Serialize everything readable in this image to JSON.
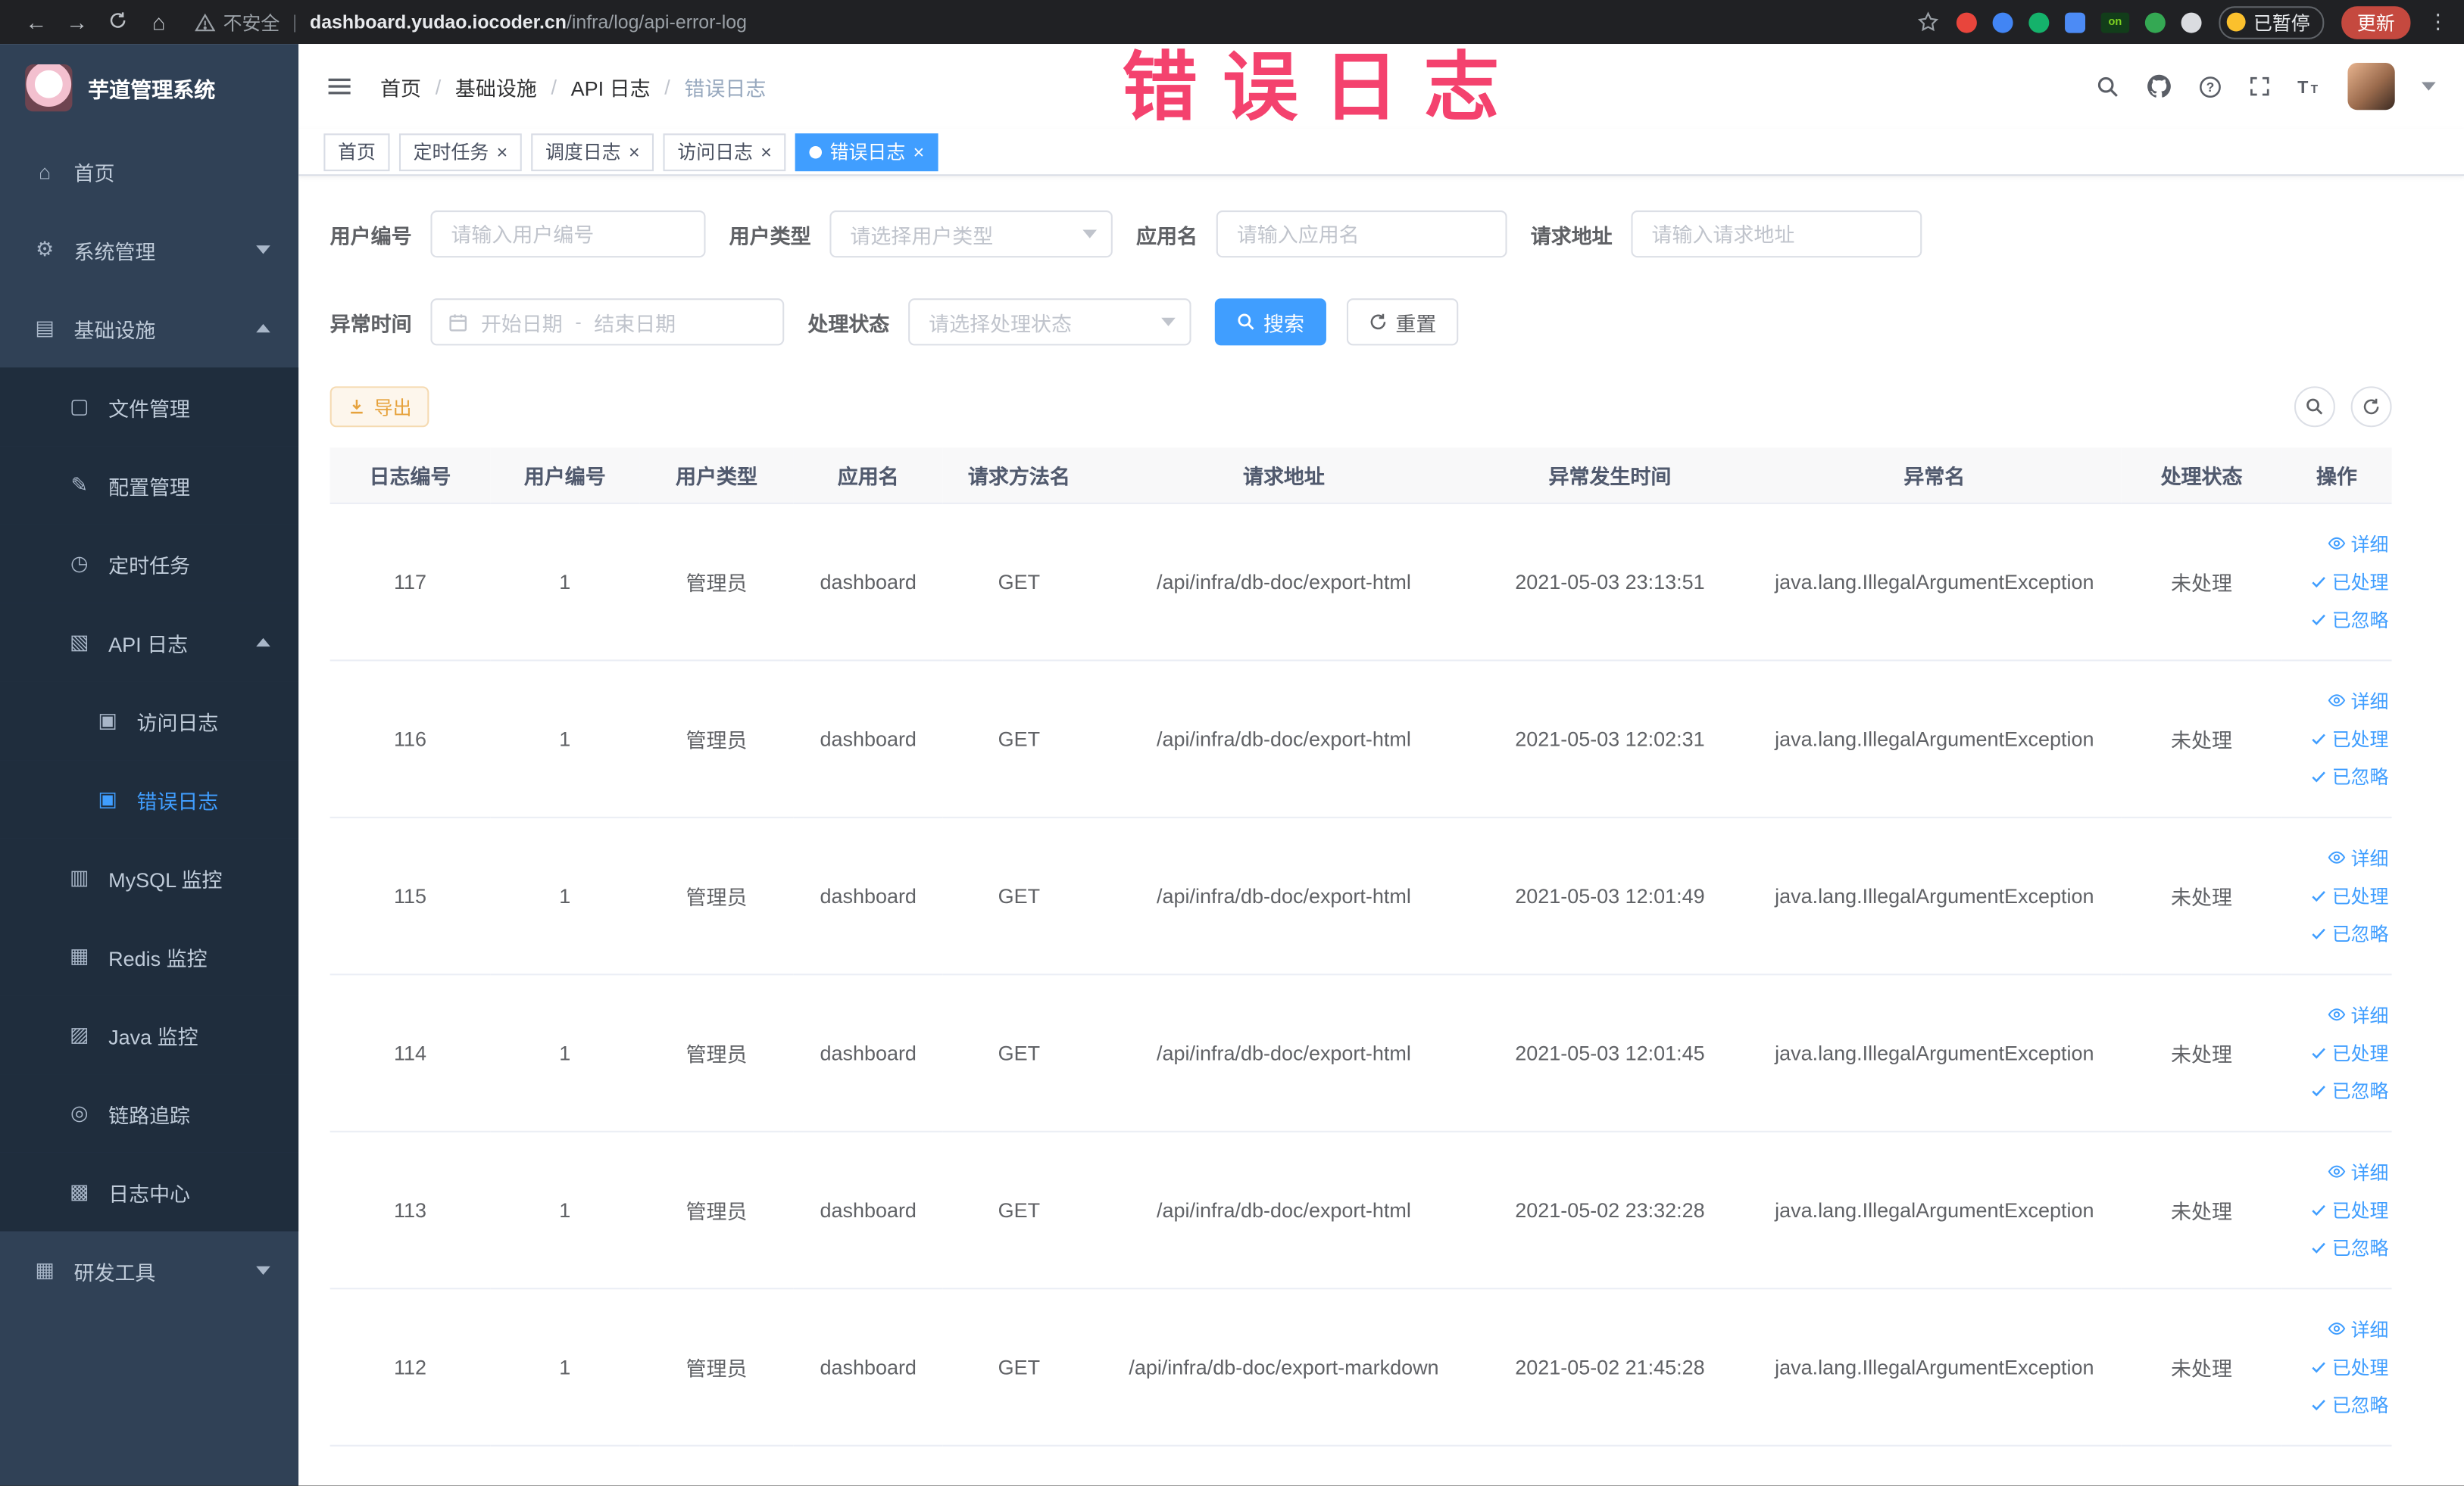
{
  "browser": {
    "security_label": "不安全",
    "url_host": "dashboard.yudao.iocoder.cn",
    "url_path": "/infra/log/api-error-log",
    "paused_badge": "已暂停",
    "update_button": "更新",
    "extensions": [
      {
        "name": "extension-red-circle-icon",
        "shape": "circle",
        "color": "#e8453c"
      },
      {
        "name": "extension-blue-drop-icon",
        "shape": "circle",
        "color": "#4285f4"
      },
      {
        "name": "extension-green-circle-icon",
        "shape": "circle",
        "color": "#15b26b"
      },
      {
        "name": "extension-blue-grid-icon",
        "shape": "square",
        "color": "#4c8bf5"
      },
      {
        "name": "extension-on-badge-icon",
        "shape": "on",
        "color": "#123d1a",
        "label": "on"
      },
      {
        "name": "extension-green-leaf-icon",
        "shape": "circle",
        "color": "#34a853"
      },
      {
        "name": "extension-paw-icon",
        "shape": "circle",
        "color": "#dadce0"
      }
    ]
  },
  "annotation": {
    "text": "错误日志",
    "color": "#f4426e"
  },
  "sidebar": {
    "logo_title": "芋道管理系统",
    "items": [
      {
        "name": "home",
        "label": "首页",
        "level": 1,
        "icon": "home-icon",
        "glyph": "⌂"
      },
      {
        "name": "system-management",
        "label": "系统管理",
        "level": 1,
        "icon": "gear-icon",
        "glyph": "⚙",
        "arrow": "down"
      },
      {
        "name": "infrastructure",
        "label": "基础设施",
        "level": 1,
        "icon": "infrastructure-icon",
        "glyph": "▤",
        "arrow": "up"
      },
      {
        "name": "file-management",
        "label": "文件管理",
        "level": 2,
        "icon": "file-icon",
        "glyph": "▢"
      },
      {
        "name": "config-management",
        "label": "配置管理",
        "level": 2,
        "icon": "config-icon",
        "glyph": "✎"
      },
      {
        "name": "scheduled-tasks",
        "label": "定时任务",
        "level": 2,
        "icon": "timer-icon",
        "glyph": "◷"
      },
      {
        "name": "api-log",
        "label": "API 日志",
        "level": 2,
        "icon": "api-log-icon",
        "glyph": "▧",
        "arrow": "up"
      },
      {
        "name": "access-log",
        "label": "访问日志",
        "level": 3,
        "icon": "access-log-icon",
        "glyph": "▣"
      },
      {
        "name": "error-log",
        "label": "错误日志",
        "level": 3,
        "icon": "error-log-icon",
        "glyph": "▣",
        "active": true
      },
      {
        "name": "mysql-monitor",
        "label": "MySQL 监控",
        "level": 2,
        "icon": "mysql-icon",
        "glyph": "▥"
      },
      {
        "name": "redis-monitor",
        "label": "Redis 监控",
        "level": 2,
        "icon": "redis-icon",
        "glyph": "▦"
      },
      {
        "name": "java-monitor",
        "label": "Java 监控",
        "level": 2,
        "icon": "java-icon",
        "glyph": "▨"
      },
      {
        "name": "link-tracing",
        "label": "链路追踪",
        "level": 2,
        "icon": "trace-icon",
        "glyph": "◎"
      },
      {
        "name": "log-center",
        "label": "日志中心",
        "level": 2,
        "icon": "log-center-icon",
        "glyph": "▩"
      },
      {
        "name": "dev-tools",
        "label": "研发工具",
        "level": 1,
        "icon": "tools-icon",
        "glyph": "▦",
        "arrow": "down"
      }
    ]
  },
  "breadcrumb": [
    "首页",
    "基础设施",
    "API 日志",
    "错误日志"
  ],
  "tabs": [
    {
      "name": "home",
      "label": "首页",
      "closable": false,
      "active": false
    },
    {
      "name": "scheduled-tasks",
      "label": "定时任务",
      "closable": true,
      "active": false
    },
    {
      "name": "job-log",
      "label": "调度日志",
      "closable": true,
      "active": false
    },
    {
      "name": "access-log",
      "label": "访问日志",
      "closable": true,
      "active": false
    },
    {
      "name": "error-log",
      "label": "错误日志",
      "closable": true,
      "active": true
    }
  ],
  "filters": {
    "user_id_label": "用户编号",
    "user_id_placeholder": "请输入用户编号",
    "user_type_label": "用户类型",
    "user_type_placeholder": "请选择用户类型",
    "app_name_label": "应用名",
    "app_name_placeholder": "请输入应用名",
    "request_url_label": "请求地址",
    "request_url_placeholder": "请输入请求地址",
    "exception_time_label": "异常时间",
    "date_start_placeholder": "开始日期",
    "date_end_placeholder": "结束日期",
    "date_separator": "-",
    "process_status_label": "处理状态",
    "process_status_placeholder": "请选择处理状态",
    "search_label": "搜索",
    "reset_label": "重置"
  },
  "toolbar": {
    "export_label": "导出"
  },
  "table": {
    "columns": [
      "日志编号",
      "用户编号",
      "用户类型",
      "应用名",
      "请求方法名",
      "请求地址",
      "异常发生时间",
      "异常名",
      "处理状态",
      "操作"
    ],
    "rows": [
      [
        "117",
        "1",
        "管理员",
        "dashboard",
        "GET",
        "/api/infra/db-doc/export-html",
        "2021-05-03 23:13:51",
        "java.lang.IllegalArgumentException",
        "未处理"
      ],
      [
        "116",
        "1",
        "管理员",
        "dashboard",
        "GET",
        "/api/infra/db-doc/export-html",
        "2021-05-03 12:02:31",
        "java.lang.IllegalArgumentException",
        "未处理"
      ],
      [
        "115",
        "1",
        "管理员",
        "dashboard",
        "GET",
        "/api/infra/db-doc/export-html",
        "2021-05-03 12:01:49",
        "java.lang.IllegalArgumentException",
        "未处理"
      ],
      [
        "114",
        "1",
        "管理员",
        "dashboard",
        "GET",
        "/api/infra/db-doc/export-html",
        "2021-05-03 12:01:45",
        "java.lang.IllegalArgumentException",
        "未处理"
      ],
      [
        "113",
        "1",
        "管理员",
        "dashboard",
        "GET",
        "/api/infra/db-doc/export-html",
        "2021-05-02 23:32:28",
        "java.lang.IllegalArgumentException",
        "未处理"
      ],
      [
        "112",
        "1",
        "管理员",
        "dashboard",
        "GET",
        "/api/infra/db-doc/export-markdown",
        "2021-05-02 21:45:28",
        "java.lang.IllegalArgumentException",
        "未处理"
      ]
    ],
    "action_detail": "详细",
    "action_processed": "已处理",
    "action_ignored": "已忽略"
  },
  "colors": {
    "accent": "#409eff",
    "warning": "#e6a23c"
  }
}
